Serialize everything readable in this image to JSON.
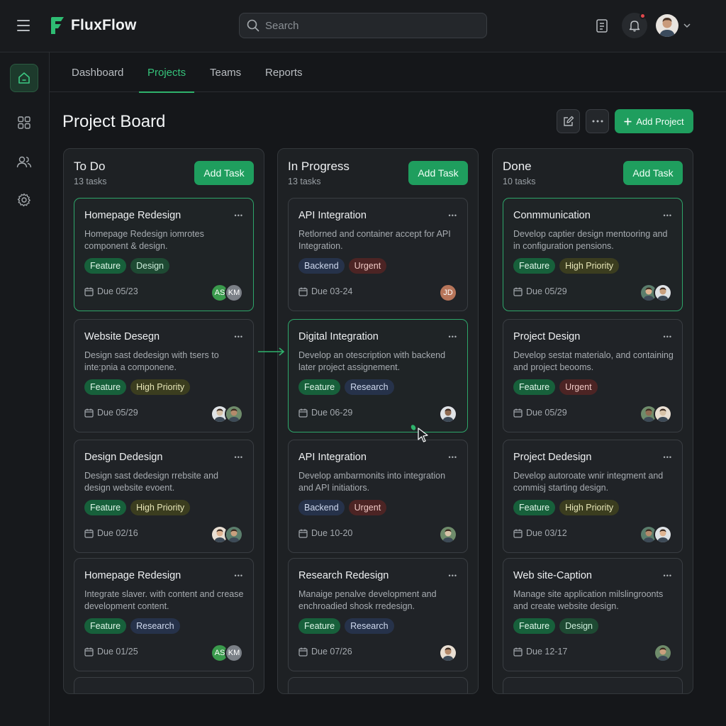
{
  "app": {
    "name": "FluxFlow",
    "brand_color": "#1f9e5e"
  },
  "search": {
    "placeholder": "Search"
  },
  "tabs": [
    {
      "label": "Dashboard",
      "active": false
    },
    {
      "label": "Projects",
      "active": true
    },
    {
      "label": "Teams",
      "active": false
    },
    {
      "label": "Reports",
      "active": false
    }
  ],
  "board": {
    "title": "Project Board",
    "add_project_label": "Add Project"
  },
  "columns": [
    {
      "title": "To Do",
      "count": "13 tasks",
      "add_label": "Add Task",
      "cards": [
        {
          "title": "Homepage Redesign",
          "desc": "Homepage Redesign iomrotes component & design.",
          "tags": [
            "Feature",
            "Design"
          ],
          "due": "Due 05/23",
          "avatars": [
            "AS",
            "KM"
          ]
        },
        {
          "title": "Website Desegn",
          "desc": "Design sast dedesign with tsers to inte:pnia a componene.",
          "tags": [
            "Feature",
            "High Priority"
          ],
          "due": "Due 05/29",
          "avatars": [
            "",
            ""
          ]
        },
        {
          "title": "Design Dedesign",
          "desc": "Design sast dedesign rrebsite and design website evoent.",
          "tags": [
            "Feature",
            "High Priority"
          ],
          "due": "Due 02/16",
          "avatars": [
            "",
            ""
          ]
        },
        {
          "title": "Homepage Redesign",
          "desc": "Integrate slaver. with content and crease development content.",
          "tags": [
            "Feature",
            "Research"
          ],
          "due": "Due 01/25",
          "avatars": [
            "AS",
            "KM"
          ]
        }
      ]
    },
    {
      "title": "In Progress",
      "count": "13 tasks",
      "add_label": "Add Task",
      "cards": [
        {
          "title": "API Integration",
          "desc": "Retlorned and container accept for API Integration.",
          "tags": [
            "Backend",
            "Urgent"
          ],
          "due": "Due 03-24",
          "avatars": [
            "JD"
          ]
        },
        {
          "title": "Digital Integration",
          "desc": "Develop an otescription with backend later project assignement.",
          "tags": [
            "Feature",
            "Research"
          ],
          "due": "Due 06-29",
          "avatars": [
            ""
          ]
        },
        {
          "title": "API Integration",
          "desc": "Develop ambarmonits into integration and API initiatiors.",
          "tags": [
            "Backend",
            "Urgent"
          ],
          "due": "Due 10-20",
          "avatars": [
            ""
          ]
        },
        {
          "title": "Research Redesign",
          "desc": "Manaige penalve development and enchroadied shosk rredesign.",
          "tags": [
            "Feature",
            "Research"
          ],
          "due": "Due 07/26",
          "avatars": [
            ""
          ]
        }
      ]
    },
    {
      "title": "Done",
      "count": "10 tasks",
      "add_label": "Add Task",
      "cards": [
        {
          "title": "Conmmunication",
          "desc": "Develop captier design mentooring and in configuration pensions.",
          "tags": [
            "Feature",
            "High Priority"
          ],
          "due": "Due 05/29",
          "avatars": [
            "",
            ""
          ]
        },
        {
          "title": "Project Design",
          "desc": "Develop sestat materialo, and containing and project beooms.",
          "tags": [
            "Feature",
            "Urgent"
          ],
          "due": "Due 05/29",
          "avatars": [
            "",
            ""
          ]
        },
        {
          "title": "Project Dedesign",
          "desc": "Develop autoroate wnir integment and commisj starting design.",
          "tags": [
            "Feature",
            "High Priority"
          ],
          "due": "Due 03/12",
          "avatars": [
            "",
            ""
          ]
        },
        {
          "title": "Web site-Caption",
          "desc": "Manage site application milslingroonts and create website design.",
          "tags": [
            "Feature",
            "Design"
          ],
          "due": "Due 12-17",
          "avatars": [
            ""
          ]
        }
      ]
    }
  ],
  "icons": {
    "menu": "hamburger-icon",
    "logo": "fluxflow-logo-icon",
    "search": "search-icon",
    "clipboard": "clipboard-icon",
    "bell": "bell-icon",
    "chevron": "chevron-down-icon",
    "home": "home-icon",
    "grid": "grid-icon",
    "users": "users-icon",
    "settings": "gear-icon",
    "edit": "edit-icon",
    "more": "more-icon",
    "calendar": "calendar-icon",
    "plus": "plus-icon"
  }
}
